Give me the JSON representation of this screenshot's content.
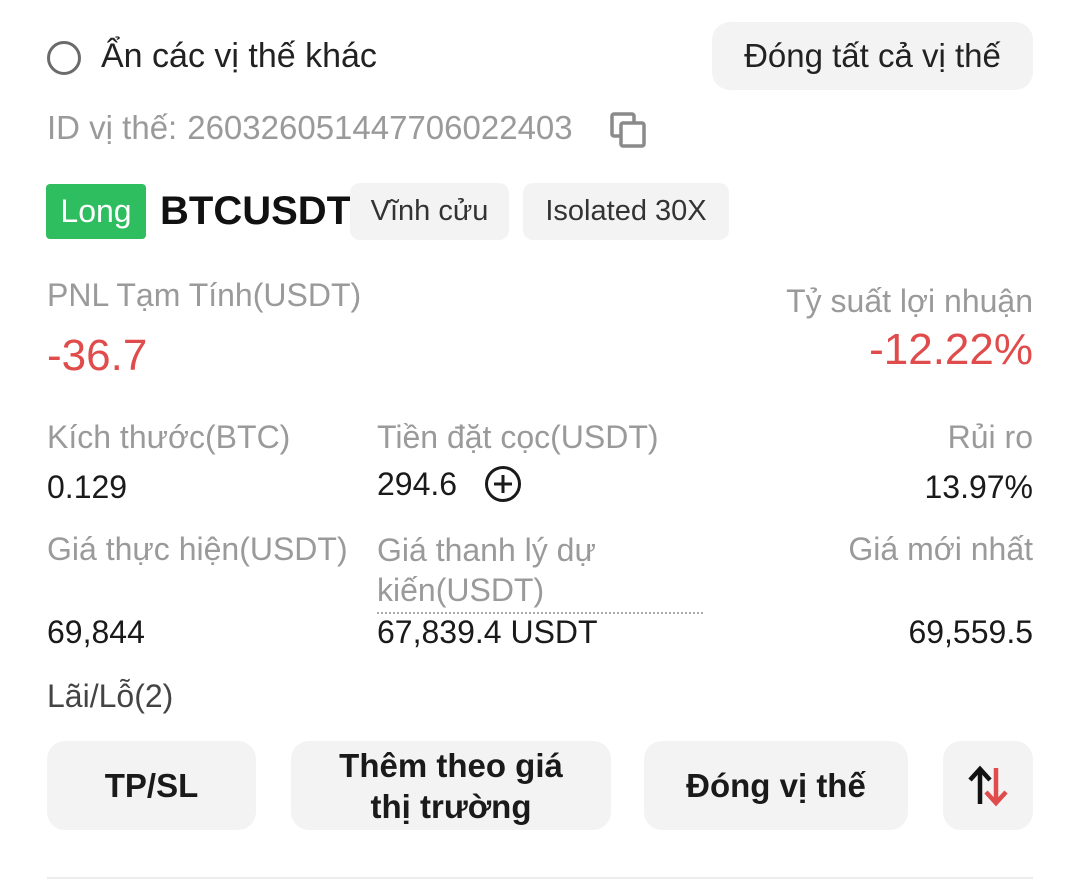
{
  "header": {
    "hide_other_positions": "Ẩn các vị thế khác",
    "close_all_positions": "Đóng tất cả vị thế"
  },
  "position": {
    "id_label": "ID vị thế:",
    "id_value": "26032605144770602240З",
    "side": "Long",
    "symbol": "BTCUSDT",
    "contract_type": "Vĩnh cửu",
    "margin_mode": "Isolated 30X",
    "pnl_label": "PNL Tạm Tính(USDT)",
    "pnl_value": "-36.7",
    "roi_label": "Tỷ suất lợi nhuận",
    "roi_value": "-12.22%",
    "size_label": "Kích thước(BTC)",
    "size_value": "0.129",
    "margin_label": "Tiền đặt cọc(USDT)",
    "margin_value": "294.6",
    "risk_label": "Rủi ro",
    "risk_value": "13.97%",
    "entry_label": "Giá thực hiện(USDT)",
    "entry_value": "69,844",
    "liq_label": "Giá thanh lý dự kiến(USDT)",
    "liq_value": "67,839.4 USDT",
    "mark_label": "Giá mới nhất",
    "mark_value": "69,559.5",
    "tpsl_count": "Lãi/Lỗ(2)"
  },
  "actions": {
    "tpsl": "TP/SL",
    "add_market": "Thêm theo giá thị trường",
    "close_position": "Đóng vị thế"
  },
  "colors": {
    "long": "#2ebd5f",
    "negative": "#e04b4b",
    "reverse_up": "#111111",
    "reverse_down": "#e04b4b"
  },
  "icons": {
    "copy": "copy-icon",
    "add_margin": "plus-circle-icon",
    "reverse": "reverse-arrows-icon",
    "radio": "radio-unchecked-icon"
  }
}
